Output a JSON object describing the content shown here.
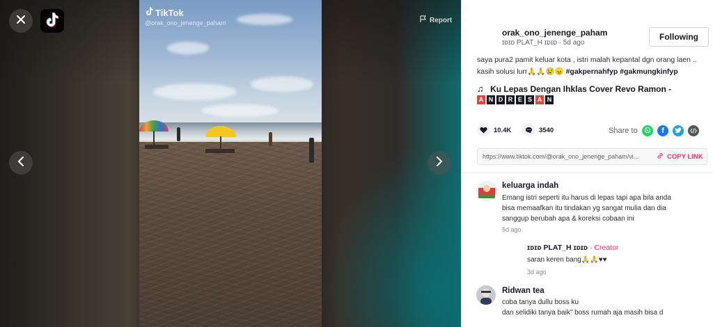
{
  "video": {
    "watermark_brand": "TikTok",
    "watermark_user": "@orak_ono_jenenge_paham",
    "report_label": "Report"
  },
  "icons": {
    "close": "close-icon",
    "logo": "tiktok-logo-icon",
    "prev": "chevron-left-icon",
    "next": "chevron-right-icon",
    "report": "flag-icon"
  },
  "author": {
    "username": "orak_ono_jenenge_paham",
    "display_name": "ɪᴅɪᴅ PLAT_H ɪᴅɪᴅ",
    "age": "5d ago",
    "follow_label": "Following"
  },
  "caption": {
    "text": "saya pura2 pamit keluar kota , istri malah kepantal dgn orang laen .. kasih solusi lurr🙏🙏😢😠",
    "hashtags": "#gakpernahfyp #gakmungkinfyp"
  },
  "music": {
    "title": "Ku Lepas Dengan Ihklas Cover Revo Ramon -",
    "artist_letters": [
      "A",
      "N",
      "D",
      "R",
      "E",
      "S",
      "A",
      "N"
    ]
  },
  "stats": {
    "likes": "10.4K",
    "comments": "3540",
    "share_label": "Share to"
  },
  "share": {
    "url": "https://www.tiktok.com/@orak_ono_jenenge_paham/vi...",
    "copy_label": "COPY LINK"
  },
  "comments": [
    {
      "name": "keluarga indah",
      "text_lines": [
        "Emang istri seperti itu harus di lepas tapi apa bila anda",
        "bisa memaafkan itu tindakan yg sangat mulia dan dia",
        "sanggup berubah apa & koreksi cobaan ini"
      ],
      "time": "5d ago"
    },
    {
      "name": "ɪᴅɪᴅ PLAT_H ɪᴅɪᴅ",
      "badge": " · Creator",
      "text": "saran keren bang🙏🙏♥♥",
      "time": "3d ago"
    },
    {
      "name": "Ridwan tea",
      "text_lines": [
        "coba tanya dullu boss ku",
        "dan selidiki tanya baik\" boss rumah aja masih bisa d"
      ]
    }
  ],
  "colors": {
    "accent": "#fe2c55",
    "whatsapp": "#25d366",
    "facebook": "#1877f2",
    "twitter": "#1da1f2",
    "embed": "#555555"
  }
}
